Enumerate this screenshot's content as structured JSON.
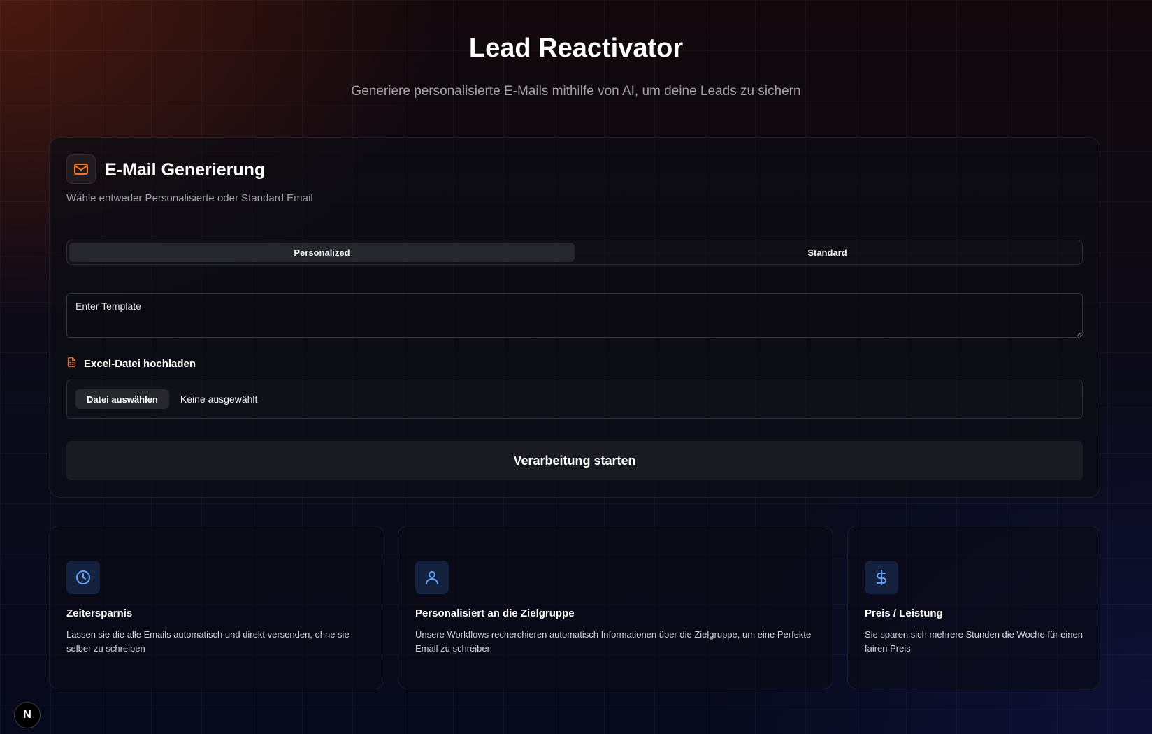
{
  "header": {
    "title": "Lead Reactivator",
    "subtitle": "Generiere personalisierte E-Mails mithilfe von AI, um deine Leads zu sichern"
  },
  "email_card": {
    "icon": "mail-icon",
    "title": "E-Mail Generierung",
    "description": "Wähle entweder Personalisierte oder Standard Email",
    "tabs": [
      {
        "label": "Personalized",
        "active": true
      },
      {
        "label": "Standard",
        "active": false
      }
    ],
    "template_placeholder": "Enter Template",
    "upload": {
      "icon": "spreadsheet-file-icon",
      "label": "Excel-Datei hochladen",
      "button_label": "Datei auswählen",
      "status": "Keine ausgewählt"
    },
    "submit_label": "Verarbeitung starten"
  },
  "features": [
    {
      "icon": "clock-icon",
      "title": "Zeitersparnis",
      "description": "Lassen sie die alle Emails automatisch und direkt versenden, ohne sie selber zu schreiben"
    },
    {
      "icon": "user-icon",
      "title": "Personalisiert an die Zielgruppe",
      "description": "Unsere Workflows recherchieren automatisch Informationen über die Zielgruppe, um eine Perfekte Email zu schreiben"
    },
    {
      "icon": "dollar-icon",
      "title": "Preis / Leistung",
      "description": "Sie sparen sich mehrere Stunden die Woche für einen fairen Preis"
    }
  ],
  "dev_badge": "N",
  "colors": {
    "accent_orange": "#f97316",
    "icon_blue": "#60a5fa",
    "background": "#080a18"
  }
}
